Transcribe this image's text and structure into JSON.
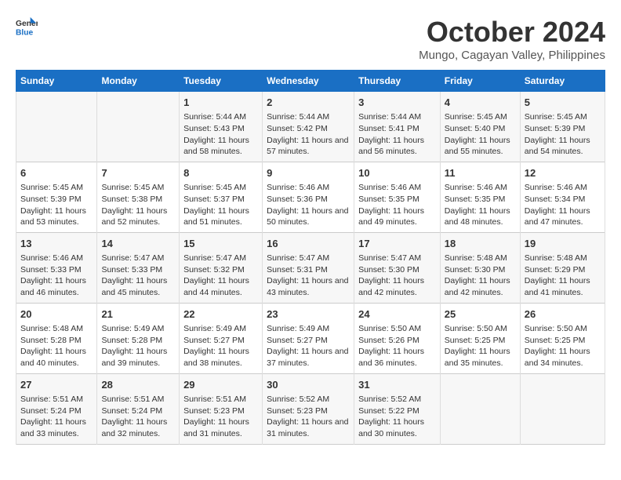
{
  "header": {
    "logo_line1": "General",
    "logo_line2": "Blue",
    "month": "October 2024",
    "location": "Mungo, Cagayan Valley, Philippines"
  },
  "weekdays": [
    "Sunday",
    "Monday",
    "Tuesday",
    "Wednesday",
    "Thursday",
    "Friday",
    "Saturday"
  ],
  "weeks": [
    [
      {
        "day": "",
        "data": ""
      },
      {
        "day": "",
        "data": ""
      },
      {
        "day": "1",
        "data": "Sunrise: 5:44 AM\nSunset: 5:43 PM\nDaylight: 11 hours and 58 minutes."
      },
      {
        "day": "2",
        "data": "Sunrise: 5:44 AM\nSunset: 5:42 PM\nDaylight: 11 hours and 57 minutes."
      },
      {
        "day": "3",
        "data": "Sunrise: 5:44 AM\nSunset: 5:41 PM\nDaylight: 11 hours and 56 minutes."
      },
      {
        "day": "4",
        "data": "Sunrise: 5:45 AM\nSunset: 5:40 PM\nDaylight: 11 hours and 55 minutes."
      },
      {
        "day": "5",
        "data": "Sunrise: 5:45 AM\nSunset: 5:39 PM\nDaylight: 11 hours and 54 minutes."
      }
    ],
    [
      {
        "day": "6",
        "data": "Sunrise: 5:45 AM\nSunset: 5:39 PM\nDaylight: 11 hours and 53 minutes."
      },
      {
        "day": "7",
        "data": "Sunrise: 5:45 AM\nSunset: 5:38 PM\nDaylight: 11 hours and 52 minutes."
      },
      {
        "day": "8",
        "data": "Sunrise: 5:45 AM\nSunset: 5:37 PM\nDaylight: 11 hours and 51 minutes."
      },
      {
        "day": "9",
        "data": "Sunrise: 5:46 AM\nSunset: 5:36 PM\nDaylight: 11 hours and 50 minutes."
      },
      {
        "day": "10",
        "data": "Sunrise: 5:46 AM\nSunset: 5:35 PM\nDaylight: 11 hours and 49 minutes."
      },
      {
        "day": "11",
        "data": "Sunrise: 5:46 AM\nSunset: 5:35 PM\nDaylight: 11 hours and 48 minutes."
      },
      {
        "day": "12",
        "data": "Sunrise: 5:46 AM\nSunset: 5:34 PM\nDaylight: 11 hours and 47 minutes."
      }
    ],
    [
      {
        "day": "13",
        "data": "Sunrise: 5:46 AM\nSunset: 5:33 PM\nDaylight: 11 hours and 46 minutes."
      },
      {
        "day": "14",
        "data": "Sunrise: 5:47 AM\nSunset: 5:33 PM\nDaylight: 11 hours and 45 minutes."
      },
      {
        "day": "15",
        "data": "Sunrise: 5:47 AM\nSunset: 5:32 PM\nDaylight: 11 hours and 44 minutes."
      },
      {
        "day": "16",
        "data": "Sunrise: 5:47 AM\nSunset: 5:31 PM\nDaylight: 11 hours and 43 minutes."
      },
      {
        "day": "17",
        "data": "Sunrise: 5:47 AM\nSunset: 5:30 PM\nDaylight: 11 hours and 42 minutes."
      },
      {
        "day": "18",
        "data": "Sunrise: 5:48 AM\nSunset: 5:30 PM\nDaylight: 11 hours and 42 minutes."
      },
      {
        "day": "19",
        "data": "Sunrise: 5:48 AM\nSunset: 5:29 PM\nDaylight: 11 hours and 41 minutes."
      }
    ],
    [
      {
        "day": "20",
        "data": "Sunrise: 5:48 AM\nSunset: 5:28 PM\nDaylight: 11 hours and 40 minutes."
      },
      {
        "day": "21",
        "data": "Sunrise: 5:49 AM\nSunset: 5:28 PM\nDaylight: 11 hours and 39 minutes."
      },
      {
        "day": "22",
        "data": "Sunrise: 5:49 AM\nSunset: 5:27 PM\nDaylight: 11 hours and 38 minutes."
      },
      {
        "day": "23",
        "data": "Sunrise: 5:49 AM\nSunset: 5:27 PM\nDaylight: 11 hours and 37 minutes."
      },
      {
        "day": "24",
        "data": "Sunrise: 5:50 AM\nSunset: 5:26 PM\nDaylight: 11 hours and 36 minutes."
      },
      {
        "day": "25",
        "data": "Sunrise: 5:50 AM\nSunset: 5:25 PM\nDaylight: 11 hours and 35 minutes."
      },
      {
        "day": "26",
        "data": "Sunrise: 5:50 AM\nSunset: 5:25 PM\nDaylight: 11 hours and 34 minutes."
      }
    ],
    [
      {
        "day": "27",
        "data": "Sunrise: 5:51 AM\nSunset: 5:24 PM\nDaylight: 11 hours and 33 minutes."
      },
      {
        "day": "28",
        "data": "Sunrise: 5:51 AM\nSunset: 5:24 PM\nDaylight: 11 hours and 32 minutes."
      },
      {
        "day": "29",
        "data": "Sunrise: 5:51 AM\nSunset: 5:23 PM\nDaylight: 11 hours and 31 minutes."
      },
      {
        "day": "30",
        "data": "Sunrise: 5:52 AM\nSunset: 5:23 PM\nDaylight: 11 hours and 31 minutes."
      },
      {
        "day": "31",
        "data": "Sunrise: 5:52 AM\nSunset: 5:22 PM\nDaylight: 11 hours and 30 minutes."
      },
      {
        "day": "",
        "data": ""
      },
      {
        "day": "",
        "data": ""
      }
    ]
  ]
}
